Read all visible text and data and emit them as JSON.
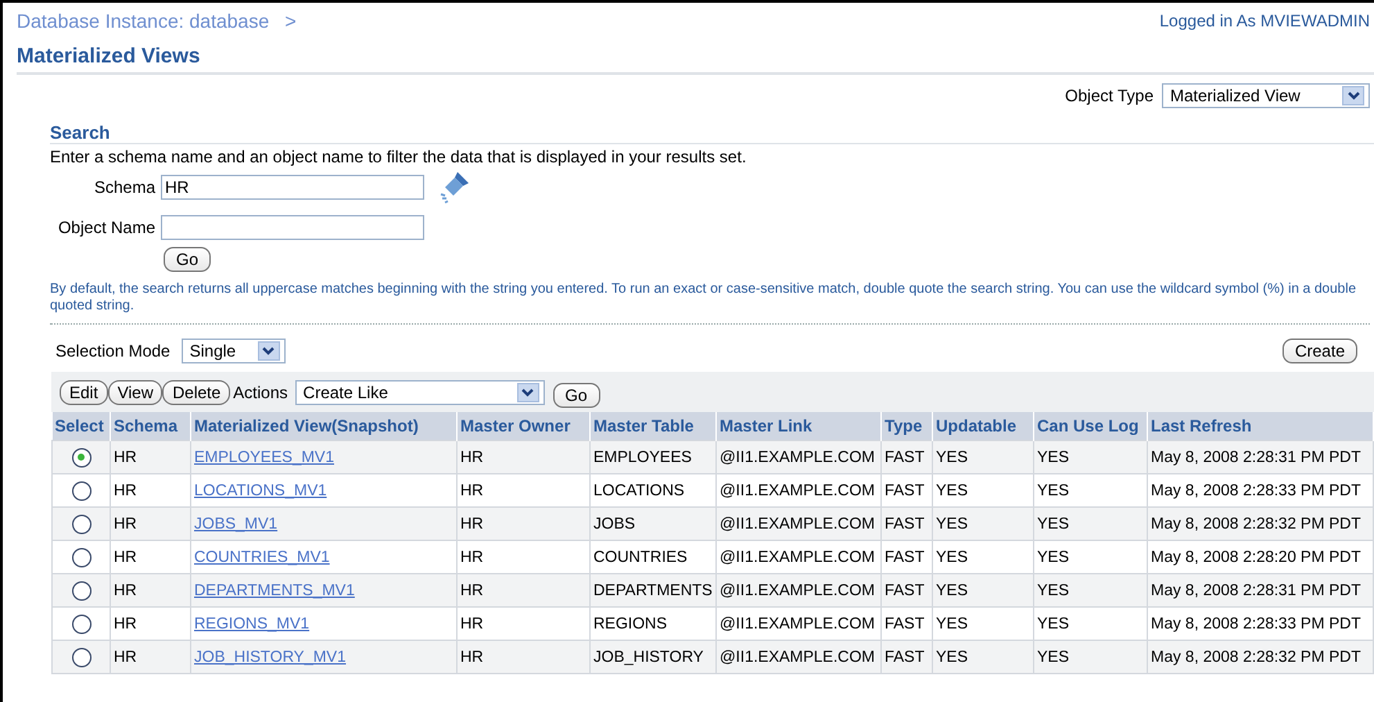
{
  "breadcrumb": {
    "text": "Database Instance: database",
    "separator": ">"
  },
  "user_info": "Logged in As MVIEWADMIN",
  "page_title": "Materialized Views",
  "object_type": {
    "label": "Object Type",
    "value": "Materialized View"
  },
  "search": {
    "heading": "Search",
    "instructions": "Enter a schema name and an object name to filter the data that is displayed in your results set.",
    "fields": [
      {
        "label": "Schema",
        "value": "HR"
      },
      {
        "label": "Object Name"
      }
    ],
    "go_button": "Go",
    "hint": "By default, the search returns all uppercase matches beginning with the string you entered. To run an exact or case-sensitive match, double quote the search string. You can use the wildcard symbol (%) in a double quoted string."
  },
  "selection_mode": {
    "label": "Selection Mode",
    "value": "Single"
  },
  "create_button": "Create",
  "toolbar": {
    "buttons": [
      "Edit",
      "View",
      "Delete"
    ],
    "actions_label": "Actions",
    "actions_value": "Create Like",
    "go_button": "Go"
  },
  "table": {
    "columns": [
      "Select",
      "Schema",
      "Materialized View(Snapshot)",
      "Master Owner",
      "Master Table",
      "Master Link",
      "Type",
      "Updatable",
      "Can Use Log",
      "Last Refresh"
    ],
    "rows": [
      {
        "cells": [
          {
            "selected": true
          },
          "HR",
          "EMPLOYEES_MV1",
          "HR",
          "EMPLOYEES",
          "@II1.EXAMPLE.COM",
          "FAST",
          "YES",
          "YES",
          "May 8, 2008 2:28:31 PM PDT"
        ]
      },
      {
        "cells": [
          {
            "selected": false
          },
          "HR",
          "LOCATIONS_MV1",
          "HR",
          "LOCATIONS",
          "@II1.EXAMPLE.COM",
          "FAST",
          "YES",
          "YES",
          "May 8, 2008 2:28:33 PM PDT"
        ]
      },
      {
        "cells": [
          {
            "selected": false
          },
          "HR",
          "JOBS_MV1",
          "HR",
          "JOBS",
          "@II1.EXAMPLE.COM",
          "FAST",
          "YES",
          "YES",
          "May 8, 2008 2:28:32 PM PDT"
        ]
      },
      {
        "cells": [
          {
            "selected": false
          },
          "HR",
          "COUNTRIES_MV1",
          "HR",
          "COUNTRIES",
          "@II1.EXAMPLE.COM",
          "FAST",
          "YES",
          "YES",
          "May 8, 2008 2:28:20 PM PDT"
        ]
      },
      {
        "cells": [
          {
            "selected": false
          },
          "HR",
          "DEPARTMENTS_MV1",
          "HR",
          "DEPARTMENTS",
          "@II1.EXAMPLE.COM",
          "FAST",
          "YES",
          "YES",
          "May 8, 2008 2:28:31 PM PDT"
        ]
      },
      {
        "cells": [
          {
            "selected": false
          },
          "HR",
          "REGIONS_MV1",
          "HR",
          "REGIONS",
          "@II1.EXAMPLE.COM",
          "FAST",
          "YES",
          "YES",
          "May 8, 2008 2:28:33 PM PDT"
        ]
      },
      {
        "cells": [
          {
            "selected": false
          },
          "HR",
          "JOB_HISTORY_MV1",
          "HR",
          "JOB_HISTORY",
          "@II1.EXAMPLE.COM",
          "FAST",
          "YES",
          "YES",
          "May 8, 2008 2:28:32 PM PDT"
        ]
      }
    ]
  }
}
